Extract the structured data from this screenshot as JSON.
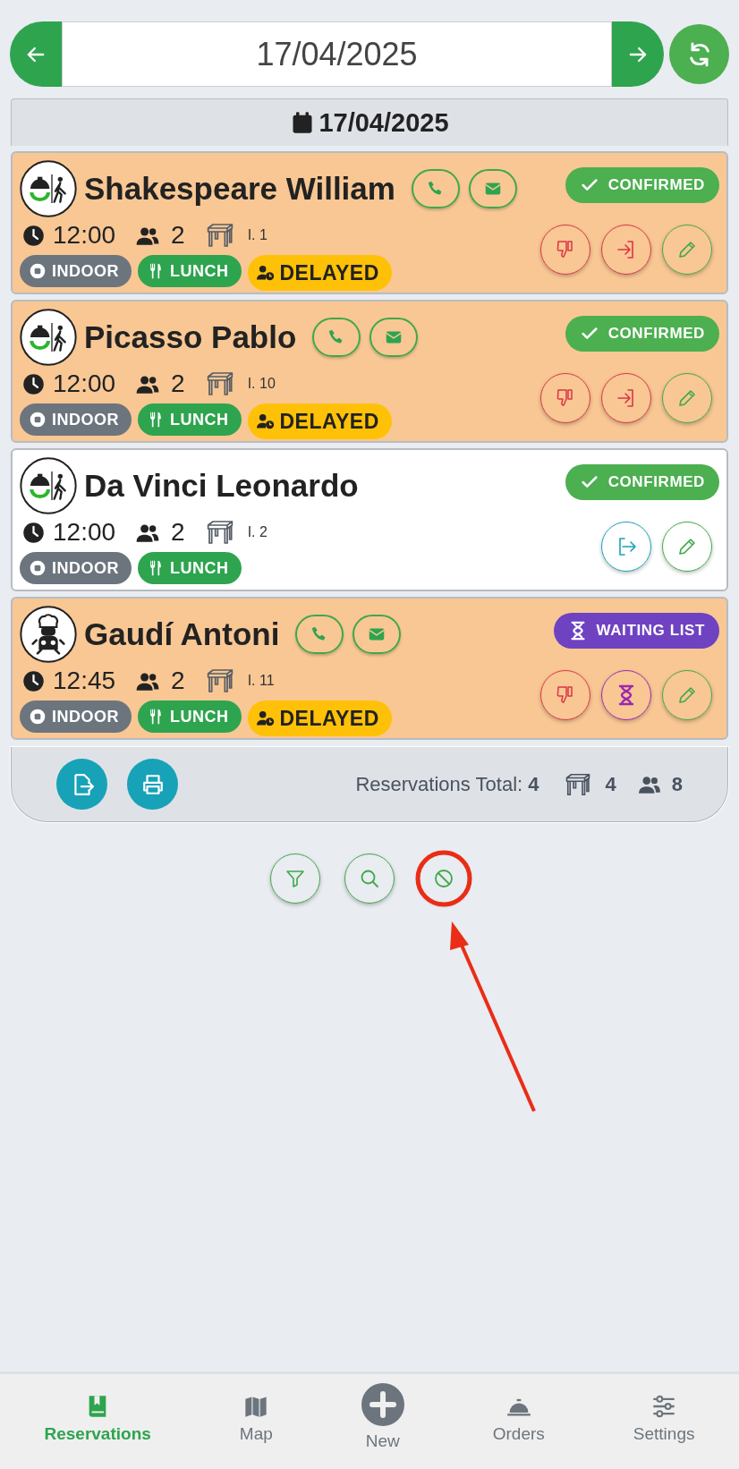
{
  "date_bar": {
    "value": "17/04/2025"
  },
  "day_header": {
    "label": "17/04/2025"
  },
  "reservations": [
    {
      "name": "Shakespeare William",
      "avatar": {
        "kind": "walk-in"
      },
      "highlighted": true,
      "contact": [
        {
          "kind": "phone"
        },
        {
          "kind": "email"
        }
      ],
      "status": {
        "label": "CONFIRMED",
        "kind": "confirmed"
      },
      "time": "12:00",
      "guests": "2",
      "table": "I. 1",
      "tags": [
        {
          "label": "INDOOR",
          "kind": "area"
        },
        {
          "label": "LUNCH",
          "kind": "meal"
        },
        {
          "label": "DELAYED",
          "kind": "delayed"
        }
      ],
      "actions": [
        {
          "kind": "no-show"
        },
        {
          "kind": "check-in"
        },
        {
          "kind": "edit"
        }
      ]
    },
    {
      "name": "Picasso Pablo",
      "avatar": {
        "kind": "walk-in"
      },
      "highlighted": true,
      "contact": [
        {
          "kind": "phone"
        },
        {
          "kind": "email"
        }
      ],
      "status": {
        "label": "CONFIRMED",
        "kind": "confirmed"
      },
      "time": "12:00",
      "guests": "2",
      "table": "I. 10",
      "tags": [
        {
          "label": "INDOOR",
          "kind": "area"
        },
        {
          "label": "LUNCH",
          "kind": "meal"
        },
        {
          "label": "DELAYED",
          "kind": "delayed"
        }
      ],
      "actions": [
        {
          "kind": "no-show"
        },
        {
          "kind": "check-in"
        },
        {
          "kind": "edit"
        }
      ]
    },
    {
      "name": "Da Vinci Leonardo",
      "avatar": {
        "kind": "walk-in"
      },
      "highlighted": false,
      "status": {
        "label": "CONFIRMED",
        "kind": "confirmed"
      },
      "time": "12:00",
      "guests": "2",
      "table": "I. 2",
      "tags": [
        {
          "label": "INDOOR",
          "kind": "area"
        },
        {
          "label": "LUNCH",
          "kind": "meal"
        }
      ],
      "actions": [
        {
          "kind": "check-out"
        },
        {
          "kind": "edit"
        }
      ]
    },
    {
      "name": "Gaudí Antoni",
      "avatar": {
        "kind": "chef"
      },
      "highlighted": true,
      "contact": [
        {
          "kind": "phone"
        },
        {
          "kind": "email"
        }
      ],
      "status": {
        "label": "WAITING LIST",
        "kind": "waiting"
      },
      "time": "12:45",
      "guests": "2",
      "table": "I. 11",
      "tags": [
        {
          "label": "INDOOR",
          "kind": "area"
        },
        {
          "label": "LUNCH",
          "kind": "meal"
        },
        {
          "label": "DELAYED",
          "kind": "delayed"
        }
      ],
      "actions": [
        {
          "kind": "no-show"
        },
        {
          "kind": "waitlist"
        },
        {
          "kind": "edit"
        }
      ]
    }
  ],
  "summary": {
    "total": "Reservations Total: **4**",
    "tables": "4",
    "guests": "8"
  },
  "tools": [
    {
      "kind": "filter"
    },
    {
      "kind": "search"
    },
    {
      "kind": "cancelled"
    }
  ],
  "nav": [
    {
      "label": "Reservations",
      "selected": true
    },
    {
      "label": "Map",
      "selected": false
    },
    {
      "label": "New",
      "selected": false
    },
    {
      "label": "Orders",
      "selected": false
    },
    {
      "label": "Settings",
      "selected": false
    }
  ]
}
